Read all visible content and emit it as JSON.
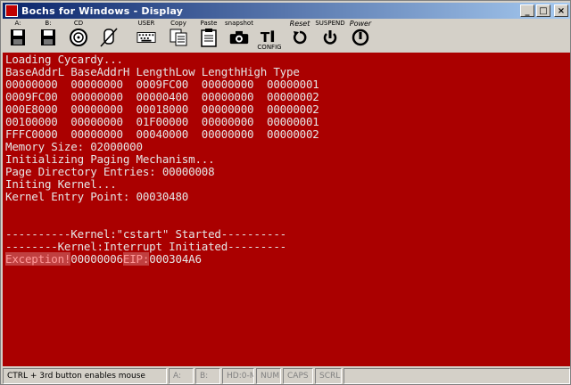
{
  "window": {
    "title": "Bochs for Windows - Display"
  },
  "title_buttons": {
    "minimize": "_",
    "maximize": "□",
    "close": "×"
  },
  "toolbar": {
    "drive_a": "A:",
    "drive_b": "B:",
    "cdrom": "CD",
    "user": "USER",
    "copy": "Copy",
    "paste": "Paste",
    "snapshot": "snapshot",
    "config": "CONFIG",
    "reset": "Reset",
    "suspend": "SUSPEND",
    "power": "Power"
  },
  "screen": {
    "bg_color": "#aa0000",
    "lines": [
      "Loading Cycardy...",
      "BaseAddrL BaseAddrH LengthLow LengthHigh Type",
      "00000000  00000000  0009FC00  00000000  00000001",
      "0009FC00  00000000  00000400  00000000  00000002",
      "000E8000  00000000  00018000  00000000  00000002",
      "00100000  00000000  01F00000  00000000  00000001",
      "FFFC0000  00000000  00040000  00000000  00000002",
      "Memory Size: 02000000",
      "Initializing Paging Mechanism...",
      "Page Directory Entries: 00000008",
      "Initing Kernel...",
      "Kernel Entry Point: 00030480",
      "",
      "",
      "----------Kernel:\"cstart\" Started----------",
      "--------Kernel:Interrupt Initiated---------"
    ],
    "exception_line": {
      "label1": "Exception!",
      "value1": "00000006",
      "label2": "EIP:",
      "value2": "000304A6"
    }
  },
  "statusbar": {
    "hint": "CTRL + 3rd button enables mouse",
    "a": "A:",
    "b": "B:",
    "hd": "HD:0-M",
    "num": "NUM",
    "caps": "CAPS",
    "scrl": "SCRL"
  }
}
